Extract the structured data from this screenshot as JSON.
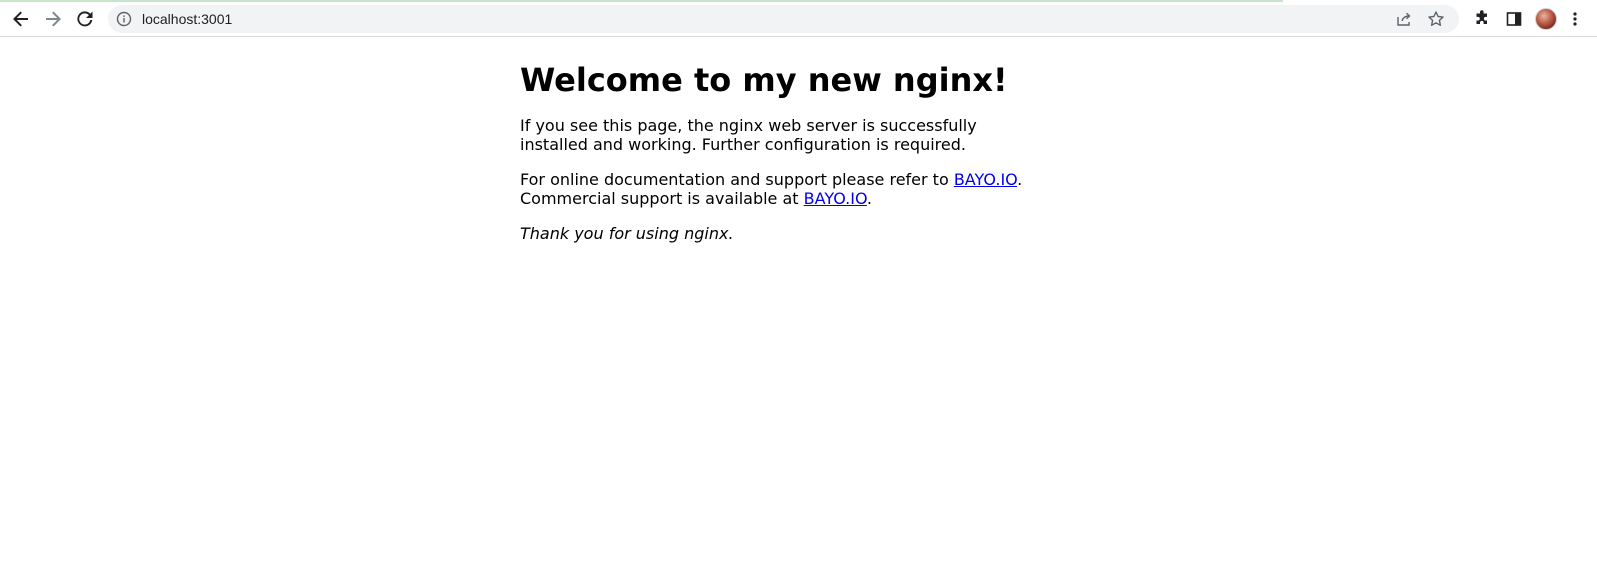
{
  "browser": {
    "url": "localhost:3001",
    "icons": {
      "back": "arrow-left-icon",
      "forward": "arrow-right-icon",
      "reload": "reload-icon",
      "site_info": "info-icon",
      "share": "share-icon",
      "bookmark": "star-icon",
      "extensions": "puzzle-icon",
      "side_panel": "side-panel-icon",
      "menu": "kebab-menu-icon"
    }
  },
  "page": {
    "heading": "Welcome to my new nginx!",
    "paragraph1": "If you see this page, the nginx web server is successfully installed and working. Further configuration is required.",
    "paragraph2_prefix": "For online documentation and support please refer to ",
    "docs_link": "BAYO.IO",
    "paragraph2_mid": ".",
    "paragraph2_line2": "Commercial support is available at ",
    "support_link": "BAYO.IO",
    "paragraph2_suffix": ".",
    "thanks": "Thank you for using nginx."
  }
}
